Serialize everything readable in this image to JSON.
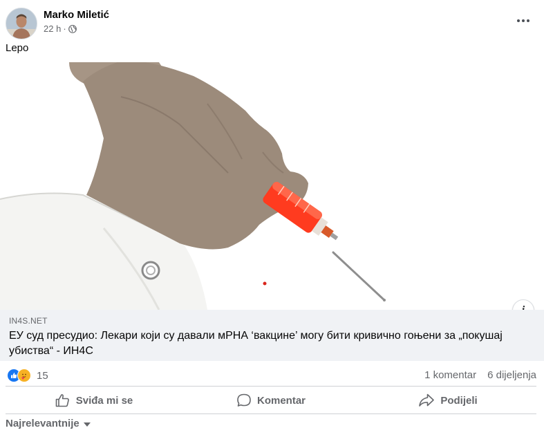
{
  "post": {
    "author": "Marko Miletić",
    "time": "22 h",
    "separator": "·",
    "audience_icon": "globe-icon",
    "text": "Lepo"
  },
  "link": {
    "domain": "IN4S.NET",
    "headline": "ЕУ суд пресудио: Лекари који су давали мРНА ‘вакцине’ могу бити кривично гоњени за „покушај убиства“ - ИН4С",
    "info_icon": "i"
  },
  "reactions": {
    "icons": [
      "like-icon",
      "care-icon"
    ],
    "count": "15",
    "comments": "1 komentar",
    "shares": "6 dijeljenja"
  },
  "actions": {
    "like": "Sviđa mi se",
    "comment": "Komentar",
    "share": "Podijeli"
  },
  "sort": {
    "label": "Najrelevantnije"
  },
  "colors": {
    "brand_blue": "#1877f2",
    "text_secondary": "#65676b",
    "footer_bg": "#f0f2f5",
    "syringe_red": "#ff3b1f"
  }
}
